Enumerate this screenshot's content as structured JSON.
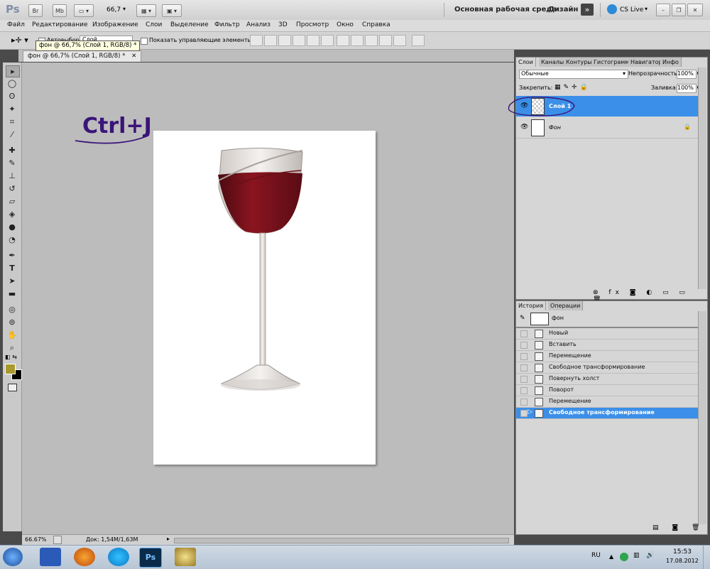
{
  "appbar": {
    "logo": "Ps",
    "br_label": "Br",
    "mb_label": "Mb",
    "zoom": "66,7",
    "workspace_label": "Основная рабочая среда",
    "design_label": "Дизайн",
    "cslive_label": "CS Live"
  },
  "menu": [
    "Файл",
    "Редактирование",
    "Изображение",
    "Слои",
    "Выделение",
    "Фильтр",
    "Анализ",
    "3D",
    "Просмотр",
    "Окно",
    "Справка"
  ],
  "options": {
    "autoselect_label": "Автовыбор:",
    "autoselect_value": "Слой",
    "show_controls_label": "Показать управляющие элементы"
  },
  "document": {
    "tab_title": "фон @ 66,7% (Слой 1, RGB/8) *",
    "tooltip": "фон @ 66,7% (Слой 1, RGB/8) *"
  },
  "annotation": {
    "text": "Ctrl+J"
  },
  "status": {
    "zoom": "66.67%",
    "doc": "Док: 1,54М/1,63М"
  },
  "layers_panel": {
    "tabs": [
      "Слои",
      "Каналы",
      "Контуры",
      "Гистограмма",
      "Навигатор",
      "Инфо"
    ],
    "blend_mode": "Обычные",
    "opacity_label": "Непрозрачность:",
    "opacity_value": "100%",
    "lock_label": "Закрепить:",
    "fill_label": "Заливка:",
    "fill_value": "100%",
    "layers": [
      {
        "name": "Слой 1",
        "selected": true
      },
      {
        "name": "Фон",
        "selected": false
      }
    ]
  },
  "history_panel": {
    "tabs": [
      "История",
      "Операции"
    ],
    "snapshot": "фон",
    "items": [
      {
        "label": "Новый"
      },
      {
        "label": "Вставить"
      },
      {
        "label": "Перемещение"
      },
      {
        "label": "Свободное трансформирование"
      },
      {
        "label": "Повернуть холст"
      },
      {
        "label": "Поворот"
      },
      {
        "label": "Перемещение"
      },
      {
        "label": "Свободное трансформирование",
        "selected": true
      }
    ]
  },
  "taskbar": {
    "lang": "RU",
    "time": "15:53",
    "date": "17.08.2012"
  },
  "colors": {
    "selection_blue": "#3b8fe8",
    "foreground_swatch": "#a89a2c",
    "annotation_purple": "#3a1478"
  }
}
